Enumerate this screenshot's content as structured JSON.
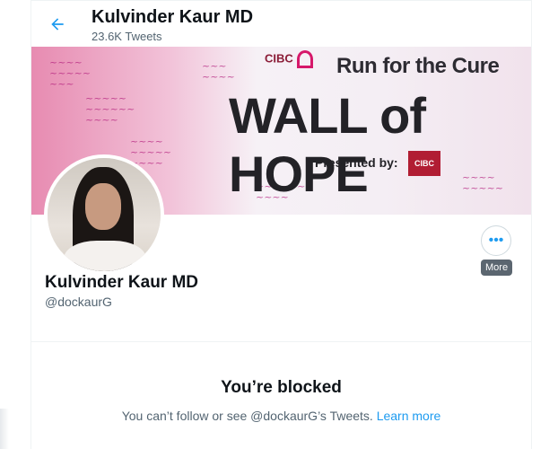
{
  "header": {
    "back_icon": "arrow-left-icon",
    "title": "Kulvinder Kaur MD",
    "subtitle": "23.6K Tweets"
  },
  "banner": {
    "brand": "CIBC",
    "event": "Run for the Cure",
    "headline": "WALL of HOPE",
    "presented": "Presented by:",
    "sponsor": "CIBC"
  },
  "profile": {
    "name": "Kulvinder Kaur MD",
    "handle": "@dockaurG",
    "more_icon": "ellipsis-icon",
    "more_tooltip": "More"
  },
  "blocked": {
    "title": "You’re blocked",
    "message": "You can’t follow or see @dockaurG’s Tweets.",
    "link": "Learn more"
  },
  "colors": {
    "accent": "#1d9bf0",
    "text_primary": "#0f1419",
    "text_secondary": "#536471"
  }
}
